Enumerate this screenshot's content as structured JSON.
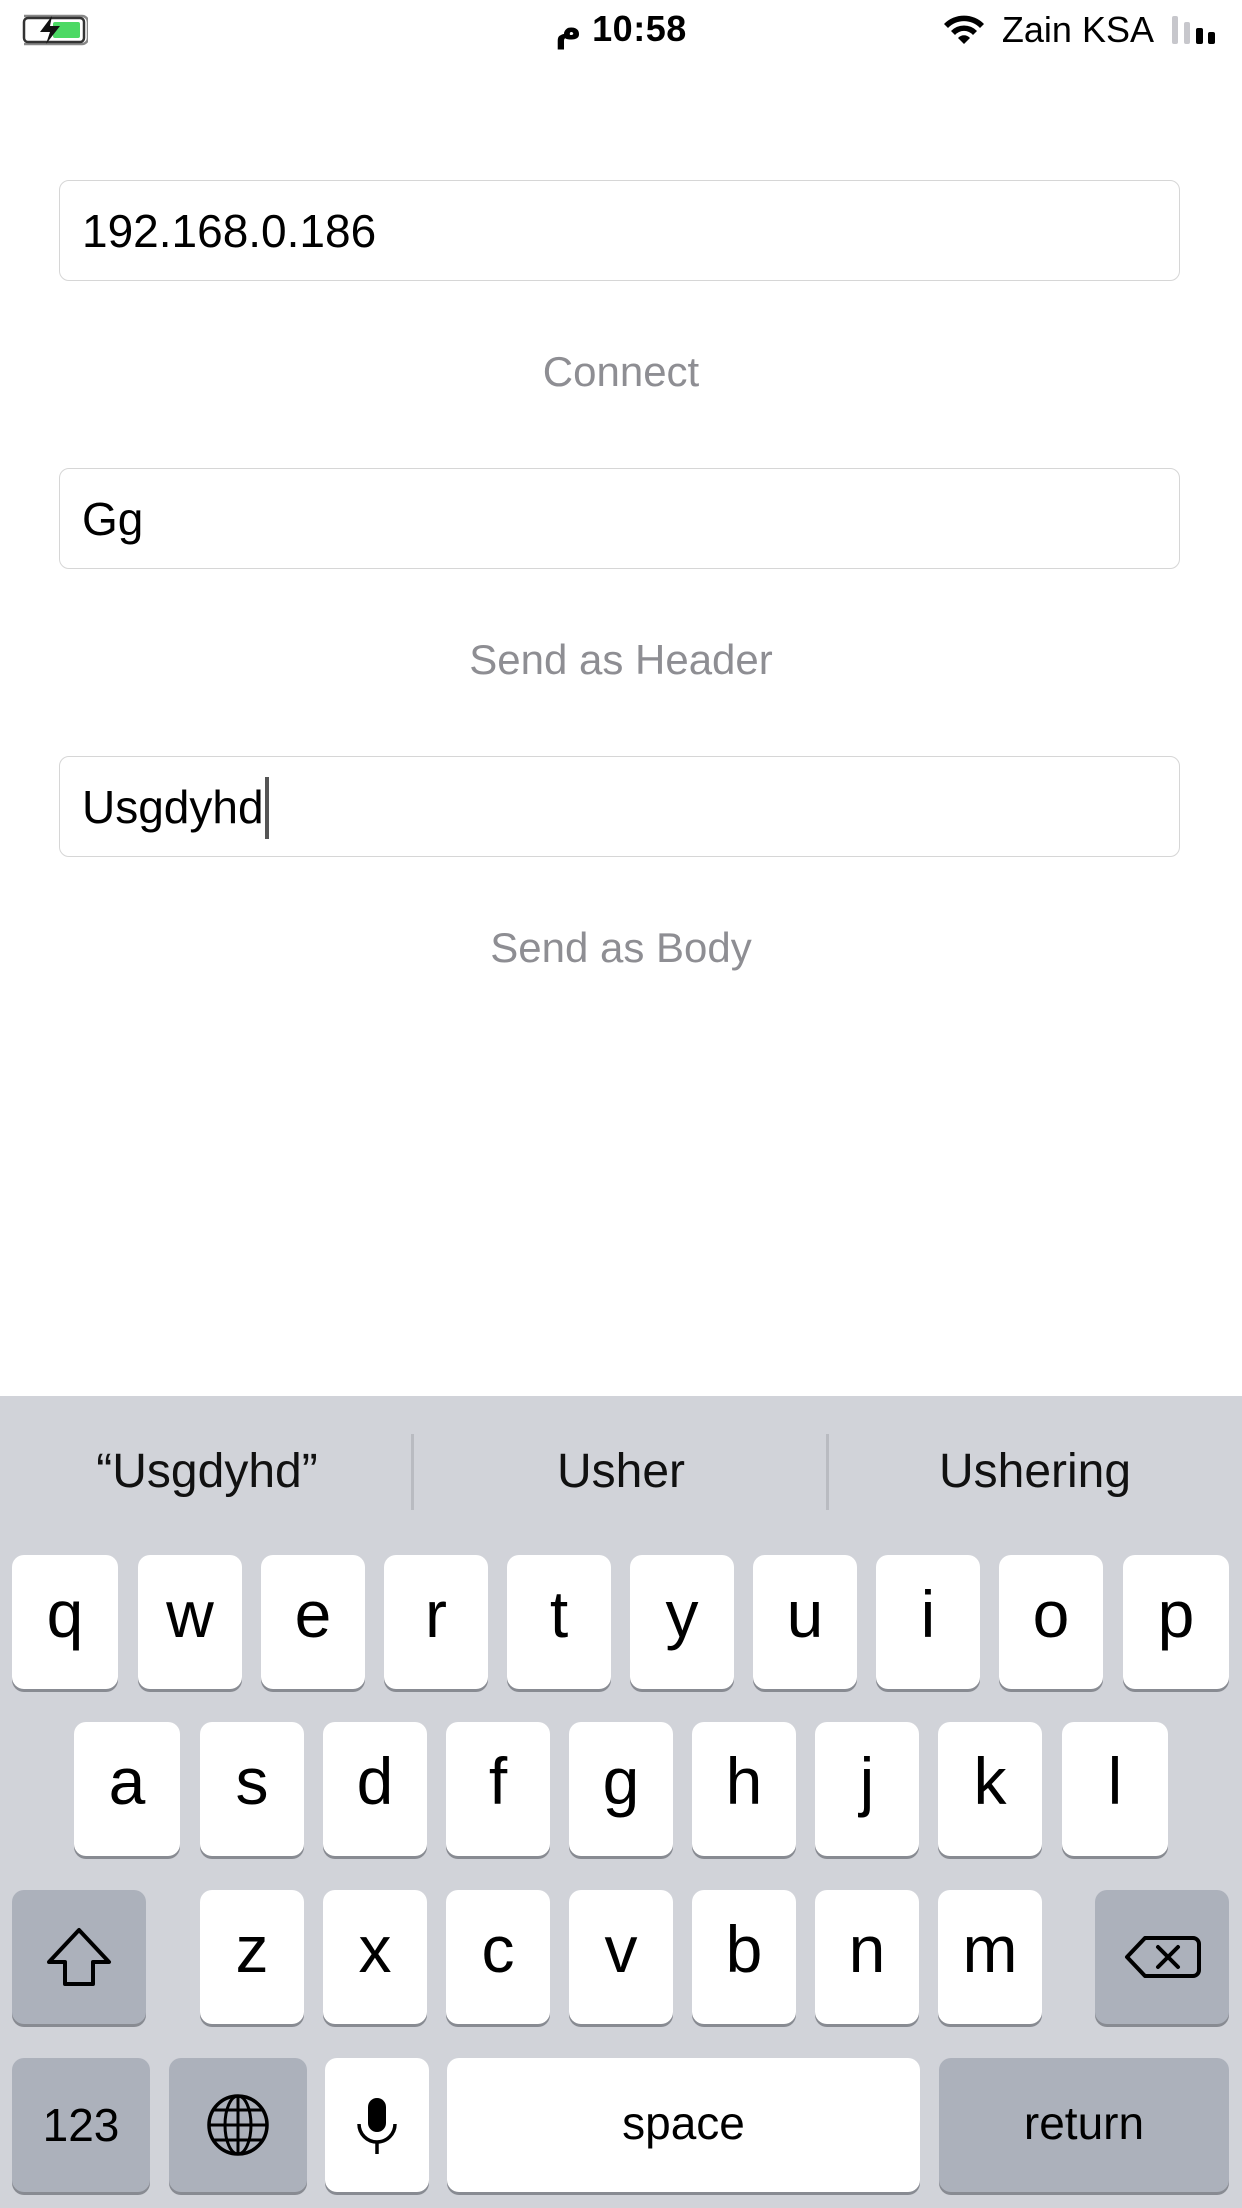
{
  "status_bar": {
    "time": "10:58",
    "time_suffix": "م",
    "carrier": "Zain KSA",
    "battery_icon": "battery-charging-icon",
    "wifi_icon": "wifi-icon",
    "signal_icon": "signal-icon"
  },
  "form": {
    "ip_value": "192.168.0.186",
    "connect_label": "Connect",
    "header_value": "Gg",
    "send_header_label": "Send as Header",
    "body_value": "Usgdyhd",
    "send_body_label": "Send as Body"
  },
  "keyboard": {
    "suggestions": [
      "“Usgdyhd”",
      "Usher",
      "Ushering"
    ],
    "row1": [
      "q",
      "w",
      "e",
      "r",
      "t",
      "y",
      "u",
      "i",
      "o",
      "p"
    ],
    "row2": [
      "a",
      "s",
      "d",
      "f",
      "g",
      "h",
      "j",
      "k",
      "l"
    ],
    "row3": [
      "z",
      "x",
      "c",
      "v",
      "b",
      "n",
      "m"
    ],
    "numbers_label": "123",
    "space_label": "space",
    "return_label": "return",
    "shift_icon": "shift-icon",
    "delete_icon": "delete-icon",
    "globe_icon": "globe-icon",
    "mic_icon": "microphone-icon"
  },
  "colors": {
    "keyboard_bg": "#d1d3d9",
    "key_bg": "#ffffff",
    "special_key_bg": "#acb1bb",
    "button_text": "#8e8e93",
    "field_border": "#d6d6d6"
  }
}
